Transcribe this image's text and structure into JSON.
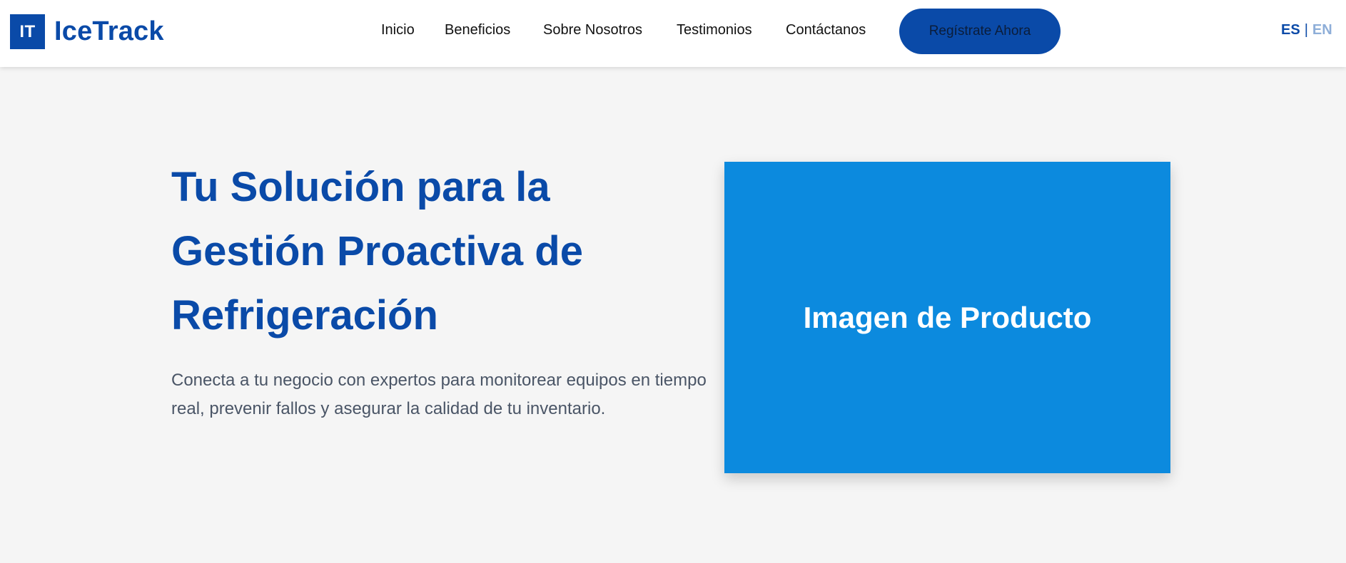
{
  "brand": {
    "mark": "IT",
    "name": "IceTrack"
  },
  "nav": {
    "items": [
      {
        "label": "Inicio"
      },
      {
        "label": "Beneficios"
      },
      {
        "label": "Sobre Nosotros"
      },
      {
        "label": "Testimonios"
      },
      {
        "label": "Contáctanos"
      }
    ],
    "cta_label": "Regístrate Ahora"
  },
  "language": {
    "active": "ES",
    "separator": "|",
    "other": "EN"
  },
  "hero": {
    "title": "Tu Solución para la Gestión Proactiva de Refrigeración",
    "subtitle": "Conecta a tu negocio con expertos para monitorear equipos en tiempo real, prevenir fallos y asegurar la calidad de tu inventario.",
    "image_placeholder": "Imagen de Producto"
  },
  "colors": {
    "brand_blue": "#0a4aa8",
    "image_blue": "#0c8ade",
    "background": "#f5f5f5",
    "text_gray": "#4a5566",
    "lang_inactive": "#8eaed8"
  }
}
